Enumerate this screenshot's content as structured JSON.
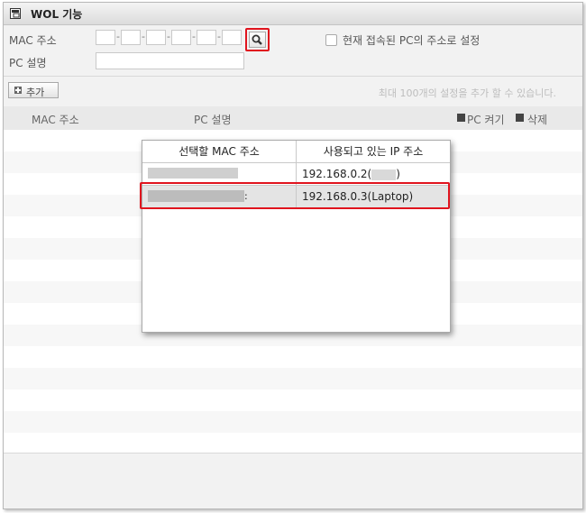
{
  "title": "WOL 기능",
  "form": {
    "mac_label": "MAC 주소",
    "mac_separator": "-",
    "pc_desc_label": "PC 설명",
    "current_pc_checkbox_label": "현재 접속된 PC의 주소로 설정"
  },
  "toolbar": {
    "add_label": "추가",
    "limit_hint": "최대 100개의 설정을 추가 할 수 있습니다."
  },
  "list": {
    "columns": [
      "MAC 주소",
      "PC 설명"
    ],
    "wake_label": "PC 켜기",
    "delete_label": "삭제"
  },
  "popup": {
    "headers": [
      "선택할 MAC 주소",
      "사용되고 있는 IP 주소"
    ],
    "rows": [
      {
        "mac": "",
        "ip_prefix": "192.168.0.2(",
        "ip_suffix": ")"
      },
      {
        "mac": "",
        "mac_tail": ":",
        "ip": "192.168.0.3(Laptop)"
      }
    ]
  },
  "colors": {
    "highlight": "#e0141e",
    "selected_row": "#e4e4e4"
  }
}
